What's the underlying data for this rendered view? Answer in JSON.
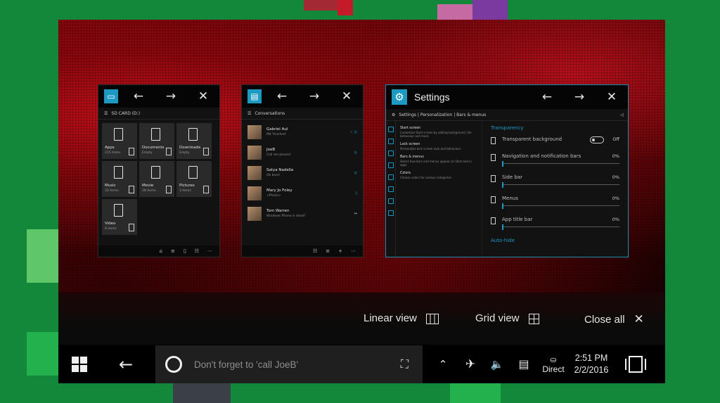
{
  "colors": {
    "accent": "#1c9ac2",
    "background": "#13883a"
  },
  "files_app": {
    "icon": "folder-icon",
    "location": "SD CARD (D:)",
    "items": [
      {
        "name": "Apps",
        "detail": "215 items"
      },
      {
        "name": "Documents",
        "detail": "Empty"
      },
      {
        "name": "Downloads",
        "detail": "Empty"
      },
      {
        "name": "Music",
        "detail": "32 items"
      },
      {
        "name": "Movie",
        "detail": "28 items"
      },
      {
        "name": "Pictures",
        "detail": "3 items"
      },
      {
        "name": "Video",
        "detail": "8 items"
      }
    ]
  },
  "messaging_app": {
    "icon": "chat-icon",
    "heading": "Conversations",
    "conversations": [
      {
        "name": "Gabriel Aul",
        "preview": "RN 'finished'"
      },
      {
        "name": "JoeB",
        "preview": "Call me please!"
      },
      {
        "name": "Satya Nadella",
        "preview": "Ok boss!"
      },
      {
        "name": "Mary Jo Foley",
        "preview": "<Photo>"
      },
      {
        "name": "Tom Warren",
        "preview": "Windows Phone is dead?"
      }
    ]
  },
  "settings_app": {
    "title": "Settings",
    "breadcrumb": "Settings | Personalization | Bars & menus",
    "left_items": [
      {
        "title": "Start screen",
        "desc": "Customize Start screen by adding background, tile behaviour and more"
      },
      {
        "title": "Lock screen",
        "desc": "Personalize lock screen look and behaviour"
      },
      {
        "title": "Bars & menus",
        "desc": "Select how bars and menus appear on Start and in apps"
      },
      {
        "title": "Colors",
        "desc": "Choose colors for various categories"
      }
    ],
    "section": "Transparency",
    "toggle": {
      "label": "Transparent background",
      "state": "Off"
    },
    "sliders": [
      {
        "label": "Navigation and notification bars",
        "value": "0%"
      },
      {
        "label": "Side bar",
        "value": "0%"
      },
      {
        "label": "Menus",
        "value": "0%"
      },
      {
        "label": "App title bar",
        "value": "0%"
      }
    ],
    "next_section": "Auto-hide"
  },
  "task_view": {
    "linear_view": "Linear view",
    "grid_view": "Grid view",
    "close_all": "Close all"
  },
  "taskbar": {
    "search_text": "Don't forget to 'call JoeB'",
    "network_label": "Direct",
    "time": "2:51 PM",
    "date": "2/2/2016"
  }
}
